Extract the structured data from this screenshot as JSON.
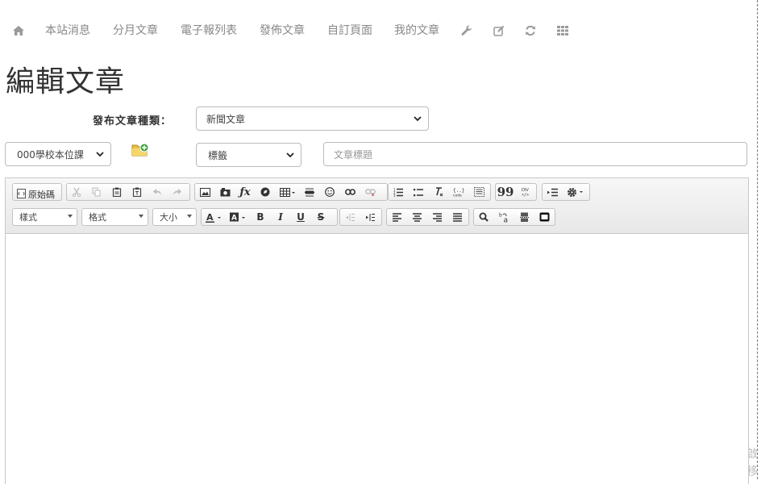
{
  "nav": {
    "links": [
      "本站消息",
      "分月文章",
      "電子報列表",
      "發佈文章",
      "自訂頁面",
      "我的文章"
    ]
  },
  "page": {
    "title": "編輯文章"
  },
  "category": {
    "label": "發布文章種類：",
    "selected": "新聞文章"
  },
  "unit_select": {
    "selected": "000學校本位課"
  },
  "tag_select": {
    "selected": "標籤"
  },
  "title_input": {
    "placeholder": "文章標題"
  },
  "editor": {
    "source_label": "原始碼",
    "style_combo": "樣式",
    "format_combo": "格式",
    "size_combo": "大小"
  },
  "corner": {
    "line1": "啟",
    "line2": "移"
  }
}
